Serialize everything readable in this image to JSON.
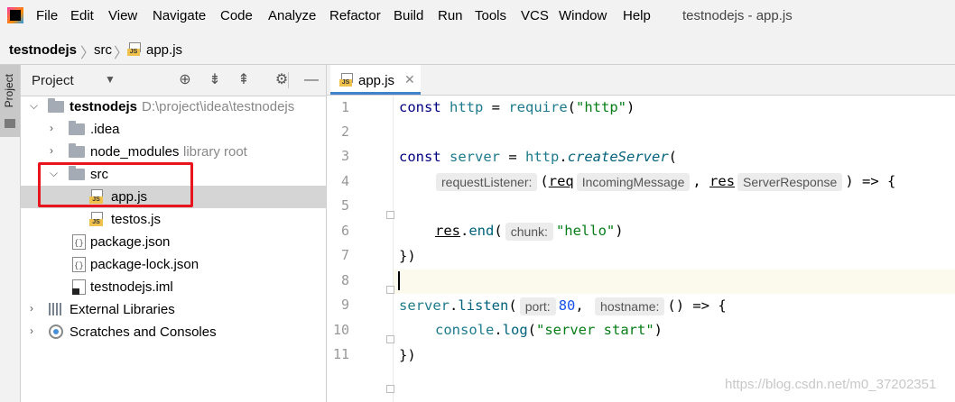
{
  "menu": {
    "items": [
      "File",
      "Edit",
      "View",
      "Navigate",
      "Code",
      "Analyze",
      "Refactor",
      "Build",
      "Run",
      "Tools",
      "VCS",
      "Window",
      "Help"
    ],
    "window_title": "testnodejs - app.js"
  },
  "breadcrumb": {
    "project": "testnodejs",
    "folder": "src",
    "file": "app.js"
  },
  "toolstrip": {
    "project_tab": "Project"
  },
  "project_panel": {
    "title": "Project",
    "tree": [
      {
        "label": "testnodejs",
        "hint": "D:\\project\\idea\\testnodejs"
      },
      {
        "label": ".idea"
      },
      {
        "label": "node_modules",
        "hint": "library root"
      },
      {
        "label": "src"
      },
      {
        "label": "app.js"
      },
      {
        "label": "testos.js"
      },
      {
        "label": "package.json"
      },
      {
        "label": "package-lock.json"
      },
      {
        "label": "testnodejs.iml"
      },
      {
        "label": "External Libraries"
      },
      {
        "label": "Scratches and Consoles"
      }
    ]
  },
  "editor": {
    "tab_label": "app.js",
    "line_numbers": [
      "1",
      "2",
      "3",
      "4",
      "5",
      "6",
      "7",
      "8",
      "9",
      "10",
      "11"
    ],
    "code": {
      "l1": {
        "kw": "const",
        "var": "http",
        "eq": " = ",
        "fn": "require",
        "open": "(",
        "str": "\"http\"",
        "close": ")"
      },
      "l3": {
        "kw": "const",
        "var": "server",
        "eq": " = ",
        "obj": "http",
        "dot": ".",
        "method": "createServer",
        "open": "("
      },
      "l4": {
        "hint1": "requestListener:",
        "p1open": "(",
        "arg1": "req",
        "hint2": "IncomingMessage",
        "comma": ", ",
        "arg2": "res",
        "hint3": "ServerResponse",
        "tail": ") => {"
      },
      "l6": {
        "obj": "res",
        "dot": ".",
        "method": "end",
        "open": "(",
        "hint": "chunk:",
        "str": "\"hello\"",
        "close": ")"
      },
      "l7": {
        "text": "})"
      },
      "l9": {
        "obj": "server",
        "dot": ".",
        "method": "listen",
        "open": "(",
        "hint1": "port:",
        "num": "80",
        "comma": ", ",
        "hint2": "hostname:",
        "tail": "() => {"
      },
      "l10": {
        "obj": "console",
        "dot": ".",
        "method": "log",
        "open": "(",
        "str": "\"server start\"",
        "close": ")"
      },
      "l11": {
        "text": "})"
      }
    }
  },
  "watermark": "https://blog.csdn.net/m0_37202351",
  "colors": {
    "highlight_box": "#e8141e",
    "tab_underline": "#4083c9",
    "selection": "#d5d5d5"
  }
}
